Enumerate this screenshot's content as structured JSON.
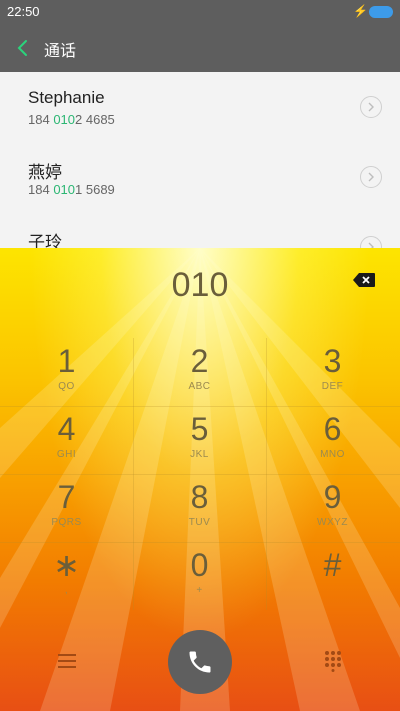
{
  "status": {
    "time": "22:50",
    "charging": "⚡"
  },
  "header": {
    "title": "通话"
  },
  "contacts": [
    {
      "name": "Stephanie",
      "num_pre": "184 ",
      "num_hl": "010",
      "num_post": "2 4685"
    },
    {
      "name": "燕婷",
      "num_pre": "184 ",
      "num_hl": "010",
      "num_post": "1 5689"
    },
    {
      "name": "子玲"
    }
  ],
  "dialer": {
    "entered": "010",
    "keys": [
      {
        "digit": "1",
        "letters": "QO"
      },
      {
        "digit": "2",
        "letters": "ABC"
      },
      {
        "digit": "3",
        "letters": "DEF"
      },
      {
        "digit": "4",
        "letters": "GHI"
      },
      {
        "digit": "5",
        "letters": "JKL"
      },
      {
        "digit": "6",
        "letters": "MNO"
      },
      {
        "digit": "7",
        "letters": "PQRS"
      },
      {
        "digit": "8",
        "letters": "TUV"
      },
      {
        "digit": "9",
        "letters": "WXYZ"
      },
      {
        "digit": "∗",
        "letters": ","
      },
      {
        "digit": "0",
        "letters": "+"
      },
      {
        "digit": "#",
        "letters": ""
      }
    ]
  },
  "icons": [
    "back-icon",
    "chevron-right-icon",
    "backspace-icon",
    "menu-icon",
    "phone-icon",
    "keypad-icon"
  ],
  "colors": {
    "highlight": "#2bb673",
    "header": "#5e5e5e",
    "call": "#5f5f5f"
  }
}
